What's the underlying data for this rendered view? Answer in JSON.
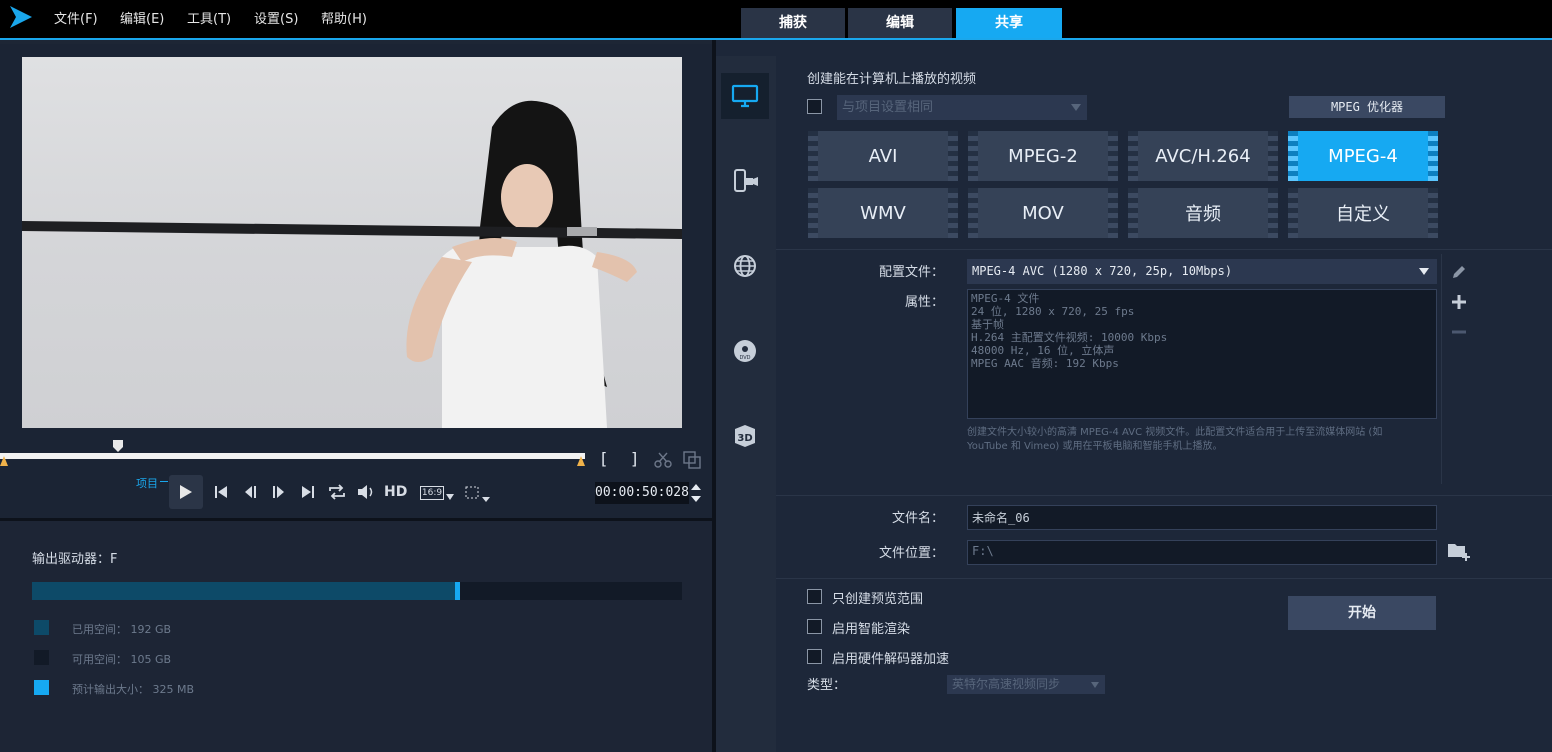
{
  "app": {
    "menu": [
      "文件(F)",
      "编辑(E)",
      "工具(T)",
      "设置(S)",
      "帮助(H)"
    ],
    "tabs": [
      {
        "label": "捕获",
        "active": false
      },
      {
        "label": "编辑",
        "active": false
      },
      {
        "label": "共享",
        "active": true
      }
    ],
    "accent": "#16a9f2"
  },
  "player": {
    "project_label": "项目",
    "timecode": "00:00:50:028",
    "hd_label": "HD",
    "aspect_label": "16:9",
    "mark_in": "[",
    "mark_out": "]"
  },
  "storage": {
    "drive_label": "输出驱动器：F",
    "used_fraction": 0.65,
    "legend": [
      {
        "label": "已用空间：  192 GB",
        "color": "#0d4a68"
      },
      {
        "label": "可用空间：  105 GB",
        "color": "#121a27"
      },
      {
        "label": "预计输出大小：  325 MB",
        "color": "#16a9f2"
      }
    ]
  },
  "share": {
    "title": "创建能在计算机上播放的视频",
    "same_as_project": "与项目设置相同",
    "mpeg_optimizer": "MPEG 优化器",
    "formats": [
      "AVI",
      "MPEG-2",
      "AVC/H.264",
      "MPEG-4",
      "WMV",
      "MOV",
      "音频",
      "自定义"
    ],
    "selected_format": "MPEG-4",
    "profile_label": "配置文件：",
    "profile_value": "MPEG-4 AVC (1280 x 720, 25p, 10Mbps)",
    "properties_label": "属性：",
    "properties": [
      "MPEG-4 文件",
      "24 位, 1280 x 720, 25 fps",
      "基于帧",
      "H.264 主配置文件视频: 10000 Kbps",
      "48000 Hz, 16 位, 立体声",
      "MPEG AAC 音频: 192 Kbps"
    ],
    "description": "创建文件大小较小的高清 MPEG-4 AVC 视频文件。此配置文件适合用于上传至流媒体网站 (如 YouTube 和 Vimeo) 或用在平板电脑和智能手机上播放。",
    "filename_label": "文件名：",
    "filename_value": "未命名_06",
    "location_label": "文件位置：",
    "location_value": "F:\\",
    "options": [
      "只创建预览范围",
      "启用智能渲染",
      "启用硬件解码器加速"
    ],
    "type_label": "类型：",
    "type_value": "英特尔高速视频同步",
    "start_button": "开始"
  }
}
